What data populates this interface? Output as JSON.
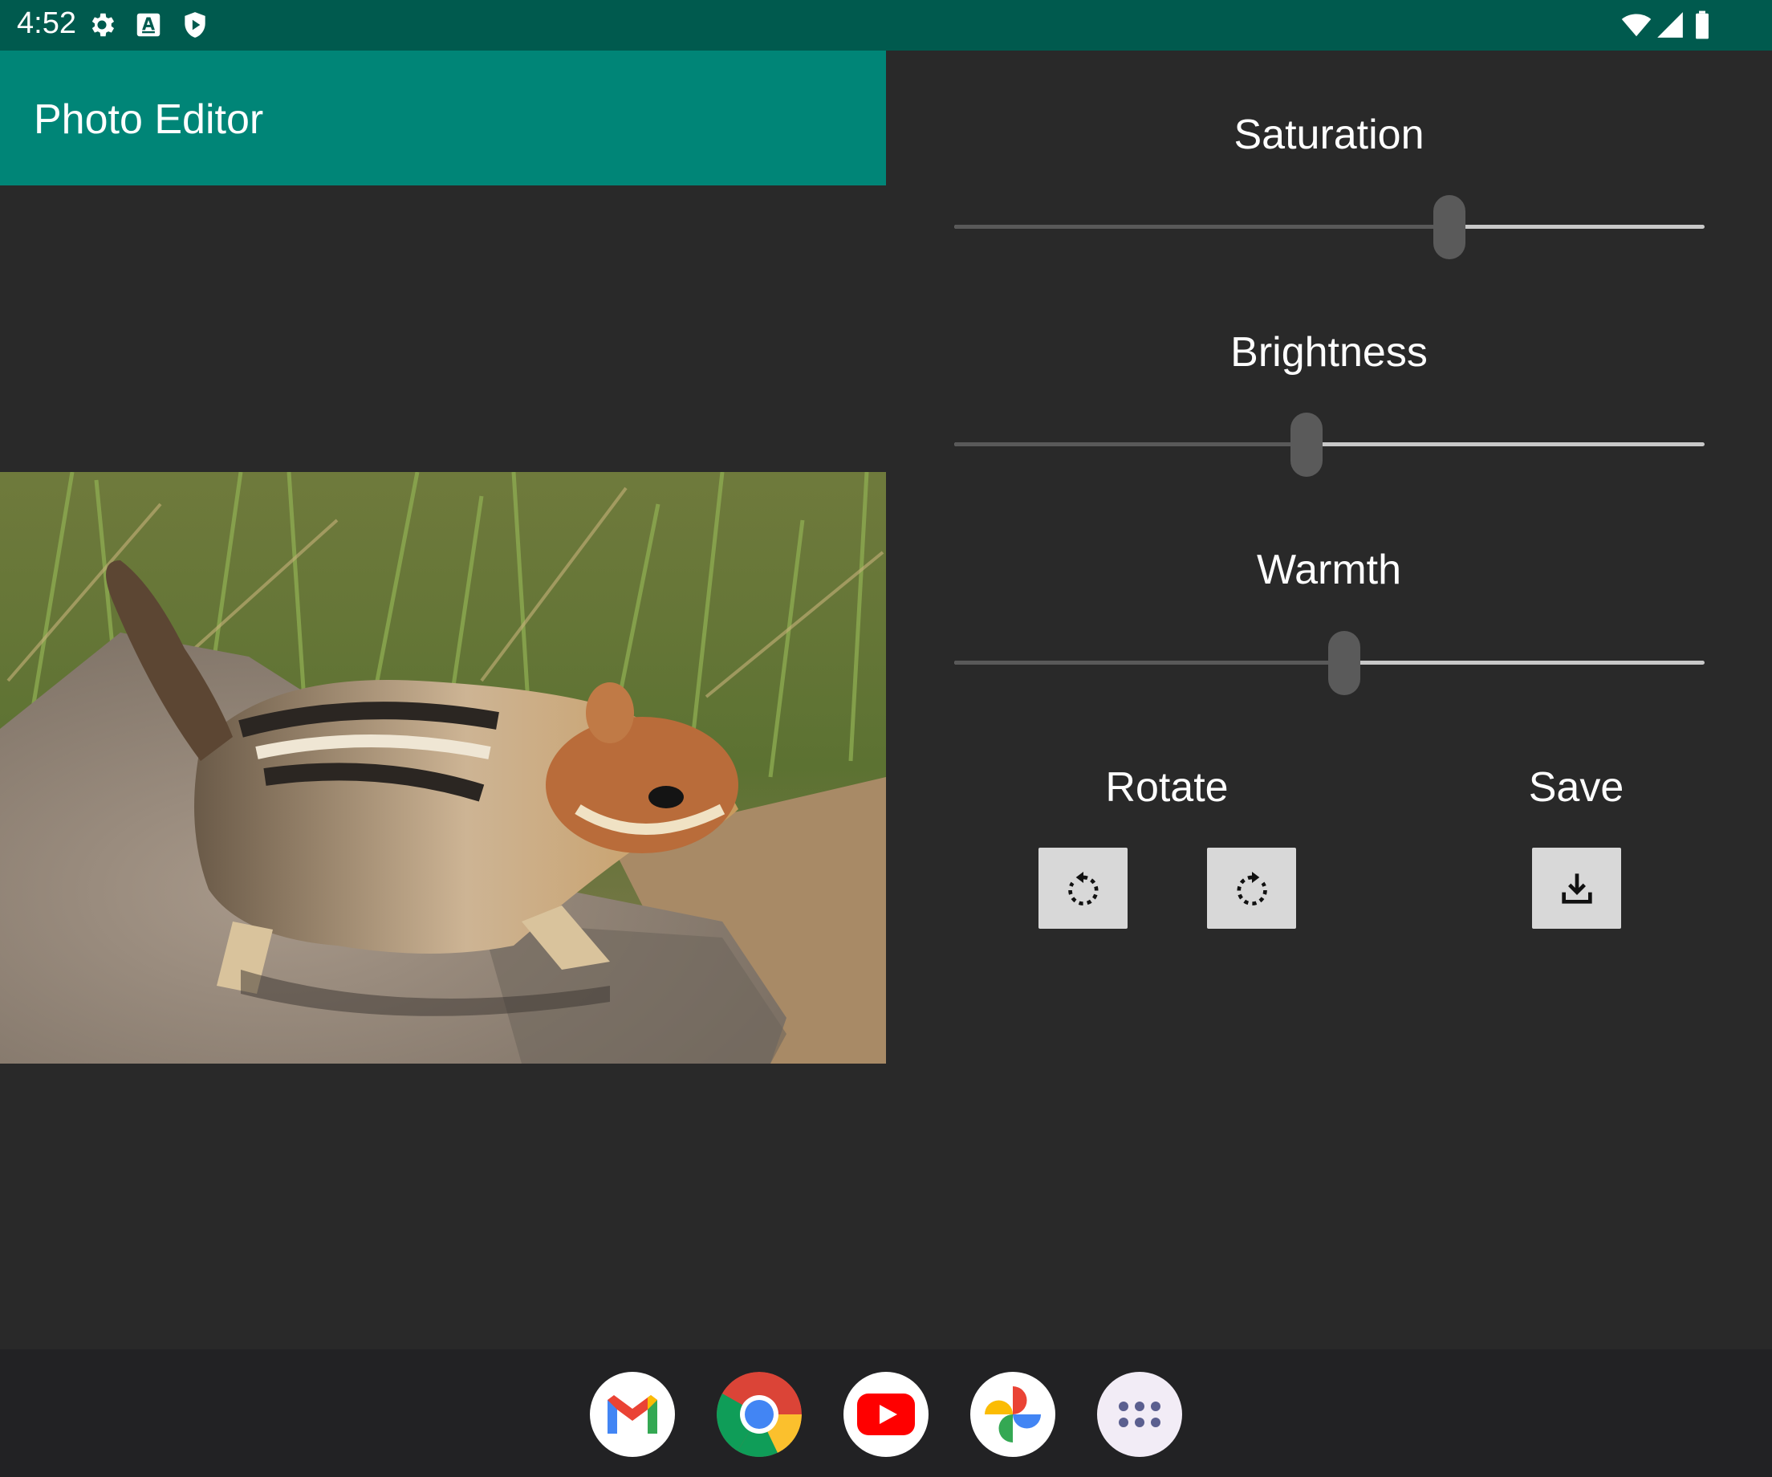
{
  "status_bar": {
    "time": "4:52",
    "left_icons": [
      "settings-icon",
      "keyboard-a-icon",
      "shield-icon"
    ],
    "right_icons": [
      "wifi-icon",
      "signal-icon",
      "battery-icon"
    ]
  },
  "app": {
    "title": "Photo Editor"
  },
  "photo": {
    "subject": "chipmunk-photo"
  },
  "controls": {
    "saturation": {
      "label": "Saturation",
      "value": 0.66
    },
    "brightness": {
      "label": "Brightness",
      "value": 0.47
    },
    "warmth": {
      "label": "Warmth",
      "value": 0.52
    },
    "rotate": {
      "label": "Rotate"
    },
    "save": {
      "label": "Save"
    }
  },
  "dock": {
    "apps": [
      "gmail-icon",
      "chrome-icon",
      "youtube-icon",
      "photos-icon",
      "app-drawer-icon"
    ]
  },
  "colors": {
    "status_bar": "#005a4e",
    "app_bar": "#008577",
    "background": "#292929",
    "button": "#d8d8d8"
  }
}
